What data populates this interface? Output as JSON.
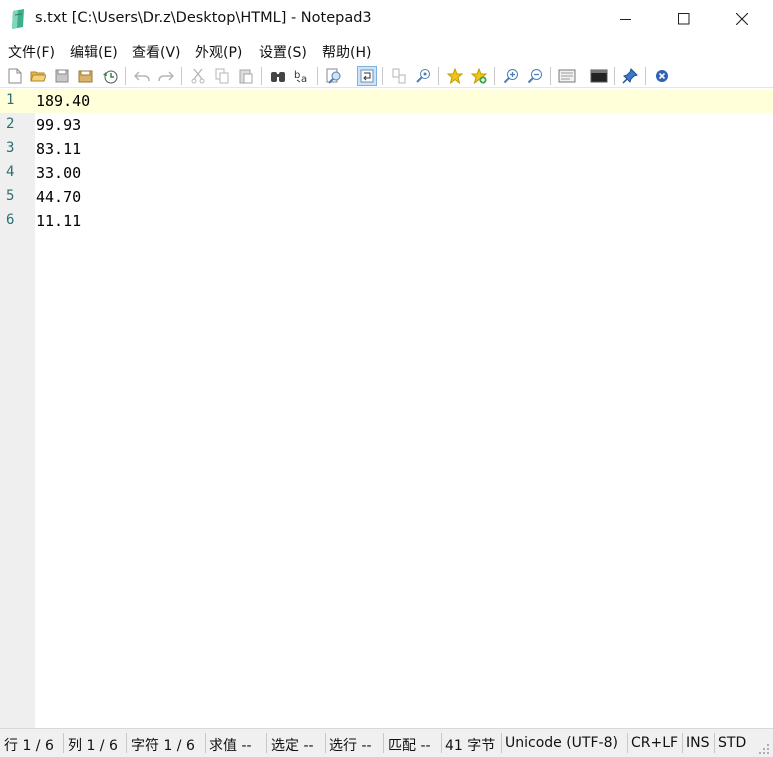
{
  "window": {
    "title": "s.txt [C:\\Users\\Dr.z\\Desktop\\HTML] - Notepad3",
    "app_icon": "notepad3-icon",
    "controls": {
      "minimize": "minimize-icon",
      "maximize": "maximize-icon",
      "close": "close-icon"
    }
  },
  "menu": {
    "items": [
      "文件(F)",
      "编辑(E)",
      "查看(V)",
      "外观(P)",
      "设置(S)",
      "帮助(H)"
    ]
  },
  "toolbar": {
    "buttons": [
      {
        "name": "new-file-icon"
      },
      {
        "name": "open-file-icon"
      },
      {
        "name": "save-icon"
      },
      {
        "name": "save-as-icon"
      },
      {
        "name": "revert-icon"
      },
      {
        "name": "undo-icon"
      },
      {
        "name": "redo-icon"
      },
      {
        "name": "cut-icon"
      },
      {
        "name": "copy-icon"
      },
      {
        "name": "paste-icon"
      },
      {
        "name": "find-icon"
      },
      {
        "name": "replace-icon"
      },
      {
        "name": "find-next-icon"
      },
      {
        "name": "word-wrap-icon",
        "active": true
      },
      {
        "name": "split-view-icon"
      },
      {
        "name": "zoom-find-icon"
      },
      {
        "name": "favorites-icon"
      },
      {
        "name": "add-favorite-icon"
      },
      {
        "name": "zoom-in-icon"
      },
      {
        "name": "zoom-out-icon"
      },
      {
        "name": "scheme-icon"
      },
      {
        "name": "console-icon"
      },
      {
        "name": "pin-icon"
      },
      {
        "name": "exit-icon"
      }
    ],
    "accent": "#7fb2de"
  },
  "editor": {
    "current_line": 1,
    "lines": [
      {
        "num": "1",
        "text": "189.40"
      },
      {
        "num": "2",
        "text": "99.93"
      },
      {
        "num": "3",
        "text": "83.11"
      },
      {
        "num": "4",
        "text": "33.00"
      },
      {
        "num": "5",
        "text": "44.70"
      },
      {
        "num": "6",
        "text": "11.11"
      }
    ],
    "line_number_color": "#2b6f73",
    "current_line_color": "#ffffd9"
  },
  "status": {
    "row": "行 1 / 6",
    "col": "列 1 / 6",
    "chars": "字符 1 / 6",
    "eval": "求值 --",
    "selection": "选定 --",
    "sel_lines": "选行 --",
    "match": "匹配 --",
    "bytes": "41 字节",
    "encoding": "Unicode (UTF-8)",
    "eol": "CR+LF",
    "ins": "INS",
    "std": "STD"
  }
}
